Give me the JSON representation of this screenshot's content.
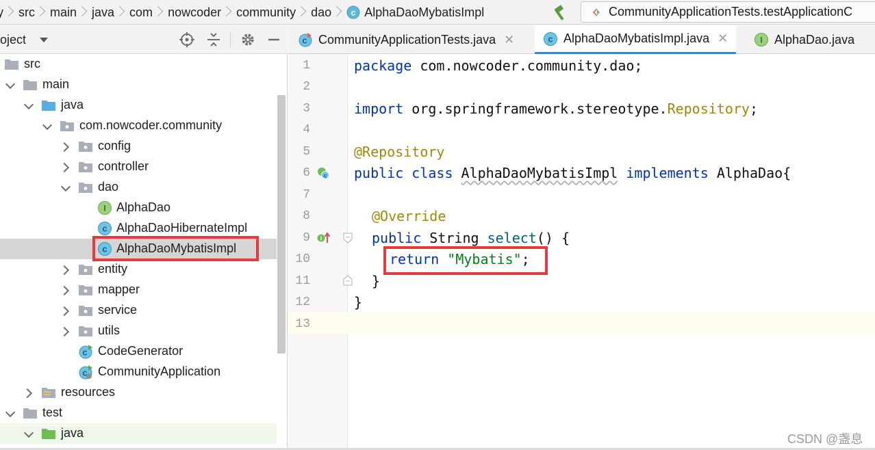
{
  "breadcrumb": [
    "y",
    "src",
    "main",
    "java",
    "com",
    "nowcoder",
    "community",
    "dao",
    "AlphaDaoMybatisImpl"
  ],
  "run_config": "CommunityApplicationTests.testApplicationC",
  "project_panel": {
    "title": "roject"
  },
  "tree": {
    "src": "src",
    "main": "main",
    "java": "java",
    "package": "com.nowcoder.community",
    "config": "config",
    "controller": "controller",
    "dao": "dao",
    "alpha_dao": "AlphaDao",
    "alpha_hibernate": "AlphaDaoHibernateImpl",
    "alpha_mybatis": "AlphaDaoMybatisImpl",
    "entity": "entity",
    "mapper": "mapper",
    "service": "service",
    "utils": "utils",
    "code_generator": "CodeGenerator",
    "community_app": "CommunityApplication",
    "resources": "resources",
    "test": "test",
    "test_java": "java"
  },
  "tabs": [
    {
      "label": "CommunityApplicationTests.java",
      "close": "✕"
    },
    {
      "label": "AlphaDaoMybatisImpl.java",
      "close": "✕"
    },
    {
      "label": "AlphaDao.java"
    }
  ],
  "editor": {
    "line_numbers": [
      "1",
      "2",
      "3",
      "4",
      "5",
      "6",
      "7",
      "8",
      "9",
      "10",
      "11",
      "12",
      "13"
    ],
    "code": {
      "l1_kw": "package",
      "l1_rest": " com.nowcoder.community.dao;",
      "l3_kw": "import",
      "l3_pkg": " org.springframework.stereotype.",
      "l3_cls": "Repository",
      "l3_end": ";",
      "l5_ann": "@Repository",
      "l6_kw1": "public",
      "l6_kw2": " class",
      "l6_name": "AlphaDaoMybatisImpl",
      "l6_kw3": "implements",
      "l6_iface": " AlphaDao{",
      "l8_ann": "@Override",
      "l9_kw": "public",
      "l9_type": " String ",
      "l9_fn": "select",
      "l9_rest": "() {",
      "l10_kw": "return",
      "l10_str": "\"Mybatis\"",
      "l10_end": ";",
      "l11": "}",
      "l12": "}"
    }
  },
  "watermark": "CSDN @盏息",
  "colors": {
    "keyword": "#0033b3",
    "annotation": "#9e880d",
    "string": "#067d17",
    "highlight": "#e8393d"
  }
}
